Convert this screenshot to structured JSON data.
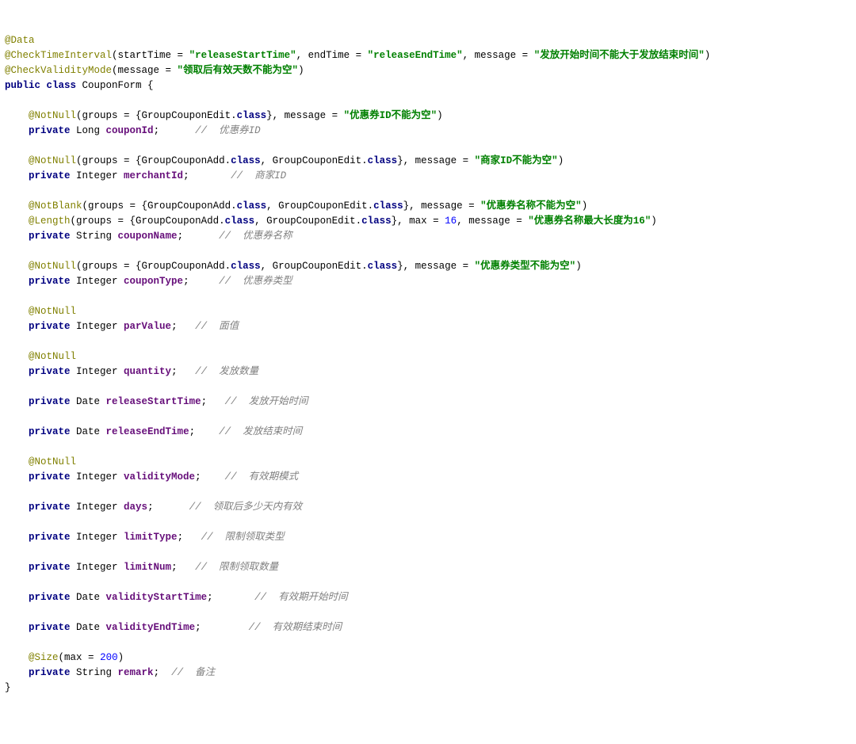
{
  "t": {
    "data": "@Data",
    "cti": "@CheckTimeInterval",
    "cvm": "@CheckValidityMode",
    "nn": "@NotNull",
    "nb": "@NotBlank",
    "len": "@Length",
    "size": "@Size",
    "pub": "public",
    "cls": "class",
    "priv": "private",
    "clsk": "class",
    "cform": " CouponForm {",
    "startTime": "startTime = ",
    "endTime": " endTime = ",
    "message": " message = ",
    "groups": "groups = {GroupCouponEdit.",
    "groups2": "groups = {GroupCouponAdd.",
    "groupEdit": ", GroupCouponEdit.",
    "closeGroups": "},",
    "max16": " max = ",
    "n16": "16",
    "n200": "200",
    "max200": "max = ",
    "closeParen": ")",
    "openParen": "(",
    "comma": ", ",
    "closeBrace": "}",
    "semi": ";",
    "long": " Long ",
    "int": " Integer ",
    "str": " String ",
    "date": " Date ",
    "couponId": "couponId",
    "merchantId": "merchantId",
    "couponName": "couponName",
    "couponType": "couponType",
    "parValue": "parValue",
    "quantity": "quantity",
    "releaseStartTime": "releaseStartTime",
    "releaseEndTime": "releaseEndTime",
    "validityMode": "validityMode",
    "days": "days",
    "limitType": "limitType",
    "limitNum": "limitNum",
    "validityStartTime": "validityStartTime",
    "validityEndTime": "validityEndTime",
    "remark": "remark"
  },
  "s": {
    "rst": "\"releaseStartTime\"",
    "ret": "\"releaseEndTime\"",
    "msg1": "\"发放开始时间不能大于发放结束时间\"",
    "msg2": "\"领取后有效天数不能为空\"",
    "msg3": "\"优惠券ID不能为空\"",
    "msg4": "\"商家ID不能为空\"",
    "msg5": "\"优惠券名称不能为空\"",
    "msg6": "\"优惠券名称最大长度为16\"",
    "msg7": "\"优惠券类型不能为空\""
  },
  "c": {
    "c1": "//  优惠券ID",
    "c2": "//  商家ID",
    "c3": "//  优惠券名称",
    "c4": "//  优惠券类型",
    "c5": "//  面值",
    "c6": "//  发放数量",
    "c7": "//  发放开始时间",
    "c8": "//  发放结束时间",
    "c9": "//  有效期模式",
    "c10": "//  领取后多少天内有效",
    "c11": "//  限制领取类型",
    "c12": "//  限制领取数量",
    "c13": "//  有效期开始时间",
    "c14": "//  有效期结束时间",
    "c15": "//  备注"
  }
}
